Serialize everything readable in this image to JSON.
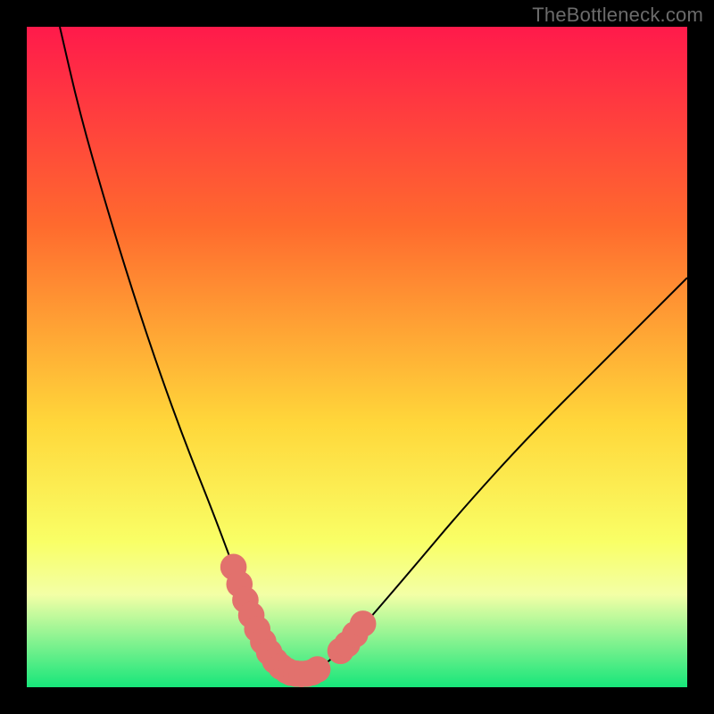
{
  "credit": "TheBottleneck.com",
  "colors": {
    "gradient_top": "#ff1a4b",
    "gradient_mid1": "#ff6a2e",
    "gradient_mid2": "#ffd73a",
    "gradient_mid3": "#f9ff66",
    "gradient_band_light": "#f3ffa6",
    "gradient_bottom": "#17e67a",
    "curve": "#000000",
    "marker": "#e2716d",
    "frame": "#000000"
  },
  "chart_data": {
    "type": "line",
    "title": "",
    "xlabel": "",
    "ylabel": "",
    "xlim": [
      0,
      100
    ],
    "ylim": [
      0,
      100
    ],
    "grid": false,
    "series": [
      {
        "name": "bottleneck-curve",
        "x": [
          5,
          8,
          12,
          16,
          20,
          24,
          28,
          31,
          33,
          35,
          37,
          38.5,
          40,
          41.5,
          43,
          45,
          48,
          52,
          58,
          66,
          76,
          88,
          100
        ],
        "y": [
          100,
          87,
          73,
          60,
          48,
          37,
          27,
          19,
          13.5,
          9,
          5.5,
          3.3,
          2.2,
          2,
          2.3,
          3.3,
          6,
          10.5,
          17.5,
          27,
          38,
          50,
          62
        ]
      }
    ],
    "markers": [
      {
        "name": "highlight-left",
        "x": [
          31.3,
          32.2,
          33.1,
          34.0,
          34.9,
          35.8,
          36.7,
          37.6,
          38.5,
          39.4
        ],
        "y": [
          18.2,
          15.6,
          13.2,
          10.9,
          8.8,
          6.9,
          5.3,
          4.0,
          3.1,
          2.5
        ]
      },
      {
        "name": "highlight-bottom",
        "x": [
          40.0,
          40.8,
          41.6,
          42.4,
          43.2,
          44.0
        ],
        "y": [
          2.2,
          2.05,
          2.0,
          2.05,
          2.25,
          2.7
        ]
      },
      {
        "name": "highlight-right",
        "x": [
          47.5,
          48.5,
          49.7,
          50.9
        ],
        "y": [
          5.5,
          6.5,
          8.0,
          9.6
        ]
      }
    ],
    "marker_radius": 2.0
  }
}
